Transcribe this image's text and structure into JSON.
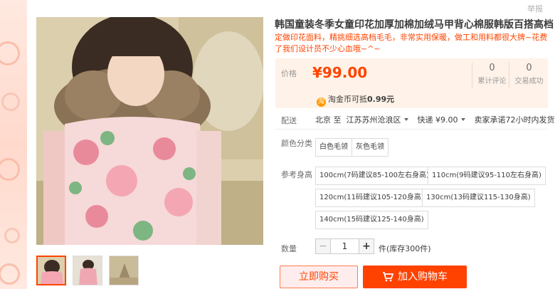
{
  "report_link": "举报",
  "product": {
    "title": "韩国童装冬季女童印花加厚加棉加绒马甲背心棉服韩版百搭高档",
    "subtitle": "定做印花面料，精挑细选高档毛毛，非常实用保暖，做工和用料都很大牌~花费了我们设计员不少心血哦~^~"
  },
  "price": {
    "label": "价格",
    "value": "¥99.00",
    "stats": [
      {
        "num": "0",
        "label": "累计评论"
      },
      {
        "num": "0",
        "label": "交易成功"
      }
    ],
    "coin": {
      "icon": "淘",
      "text": "淘金币可抵",
      "amount": "0.99元"
    }
  },
  "delivery": {
    "label": "配送",
    "from": "北京 至",
    "to": "江苏苏州沧浪区",
    "express": "快递 ¥9.00",
    "promise": "卖家承诺72小时内发货"
  },
  "color": {
    "label": "颜色分类",
    "options": [
      "白色毛领",
      "灰色毛领"
    ]
  },
  "size": {
    "label": "参考身高",
    "options": [
      "100cm(7码建议85-100左右身高)",
      "110cm(9码建议95-110左右身高)",
      "120cm(11码建议105-120身高)",
      "130cm(13码建议115-130身高)",
      "140cm(15码建议125-140身高)"
    ]
  },
  "quantity": {
    "label": "数量",
    "minus": "−",
    "value": "1",
    "plus": "+",
    "stock": "件(库存300件)"
  },
  "buttons": {
    "buy_now": "立即购买",
    "add_cart": "加入购物车"
  },
  "colors": {
    "accent": "#ff4400",
    "cart_bg": "#ff4200",
    "price_bg": "#fff2e8"
  }
}
